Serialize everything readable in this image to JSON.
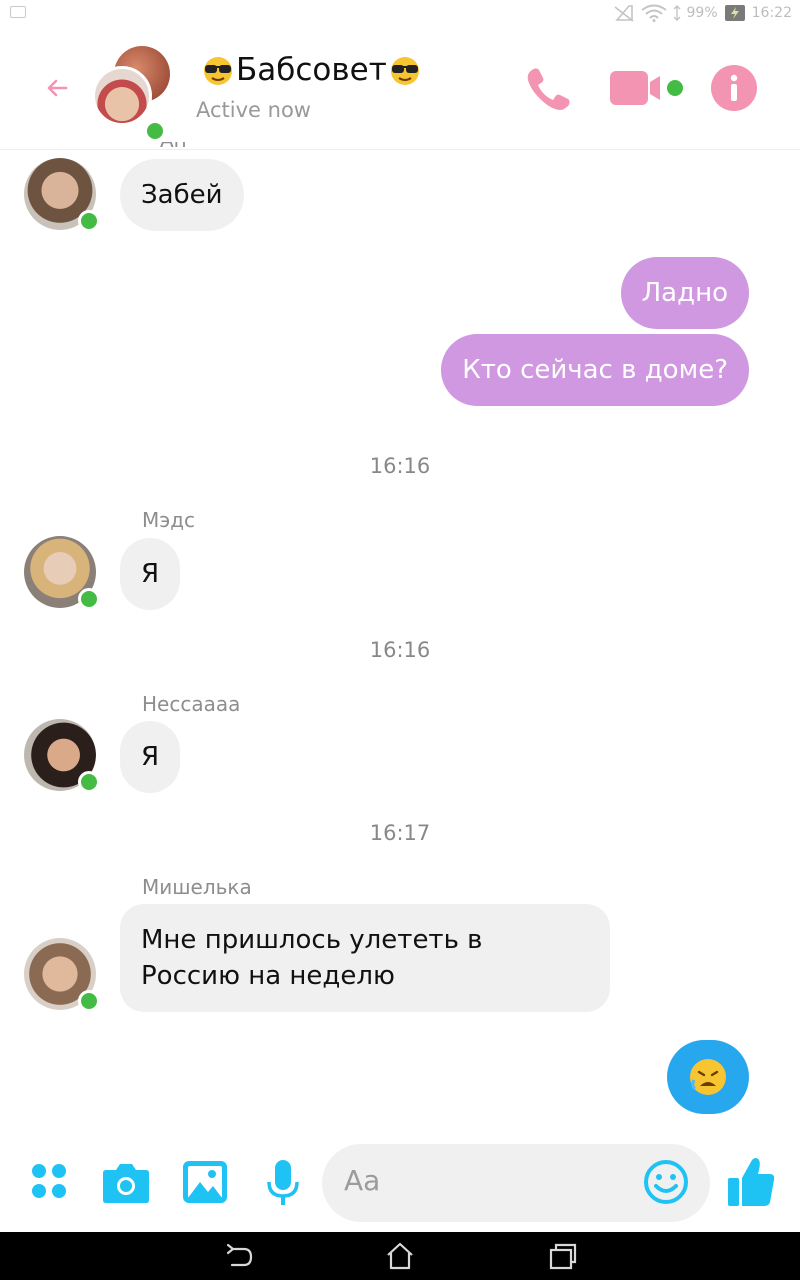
{
  "status_bar": {
    "battery": "99%",
    "time": "16:22"
  },
  "header": {
    "title": "Бабсовет",
    "subtitle": "Active now",
    "icons": [
      "back-arrow-icon",
      "phone-icon",
      "video-camera-icon",
      "info-icon"
    ],
    "accent_color": "#f394b3"
  },
  "messages": [
    {
      "type": "incoming",
      "sender": "",
      "text": "Забей"
    },
    {
      "type": "outgoing",
      "text": "Ладно"
    },
    {
      "type": "outgoing",
      "text": "Кто сейчас в доме?"
    },
    {
      "type": "time",
      "text": "16:16"
    },
    {
      "type": "incoming",
      "sender": "Мэдс",
      "text": "Я"
    },
    {
      "type": "time",
      "text": "16:16"
    },
    {
      "type": "incoming",
      "sender": "Нессаааа",
      "text": "Я"
    },
    {
      "type": "time",
      "text": "16:17"
    },
    {
      "type": "incoming",
      "sender": "Мишелька",
      "text_line1": "Мне пришлось улететь в",
      "text_line2": "Россию на неделю"
    }
  ],
  "composer": {
    "placeholder": "Aa",
    "icons": [
      "apps-icon",
      "camera-icon",
      "gallery-icon",
      "microphone-icon",
      "smiley-icon",
      "thumbs-up-icon"
    ],
    "accent_color": "#1ec3f4"
  },
  "colors": {
    "outgoing_bubble": "#cf98e0",
    "incoming_bubble": "#f1f0f0",
    "online": "#44bb44"
  }
}
